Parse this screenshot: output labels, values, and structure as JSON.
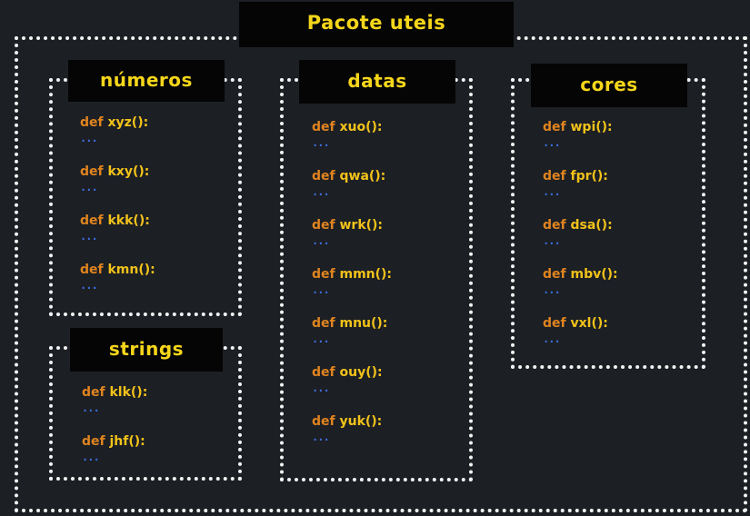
{
  "package": {
    "title": "Pacote uteis"
  },
  "modules": [
    {
      "name": "números",
      "functions": [
        "xyz():",
        "kxy():",
        "kkk():",
        "kmn():"
      ]
    },
    {
      "name": "strings",
      "functions": [
        "klk():",
        "jhf():"
      ]
    },
    {
      "name": "datas",
      "functions": [
        "xuo():",
        "qwa():",
        "wrk():",
        "mmn():",
        "mnu():",
        "ouy():",
        "yuk():"
      ]
    },
    {
      "name": "cores",
      "functions": [
        "wpi():",
        "fpr():",
        "dsa():",
        "mbv():",
        "vxl():"
      ]
    }
  ],
  "keyword": "def",
  "ellipsis": "...",
  "colors": {
    "background": "#1c1f24",
    "title_text": "#f6d61a",
    "keyword": "#e0841f",
    "function_name": "#f2c21a",
    "ellipsis": "#3d6ee0",
    "border": "#f2f2f2"
  }
}
